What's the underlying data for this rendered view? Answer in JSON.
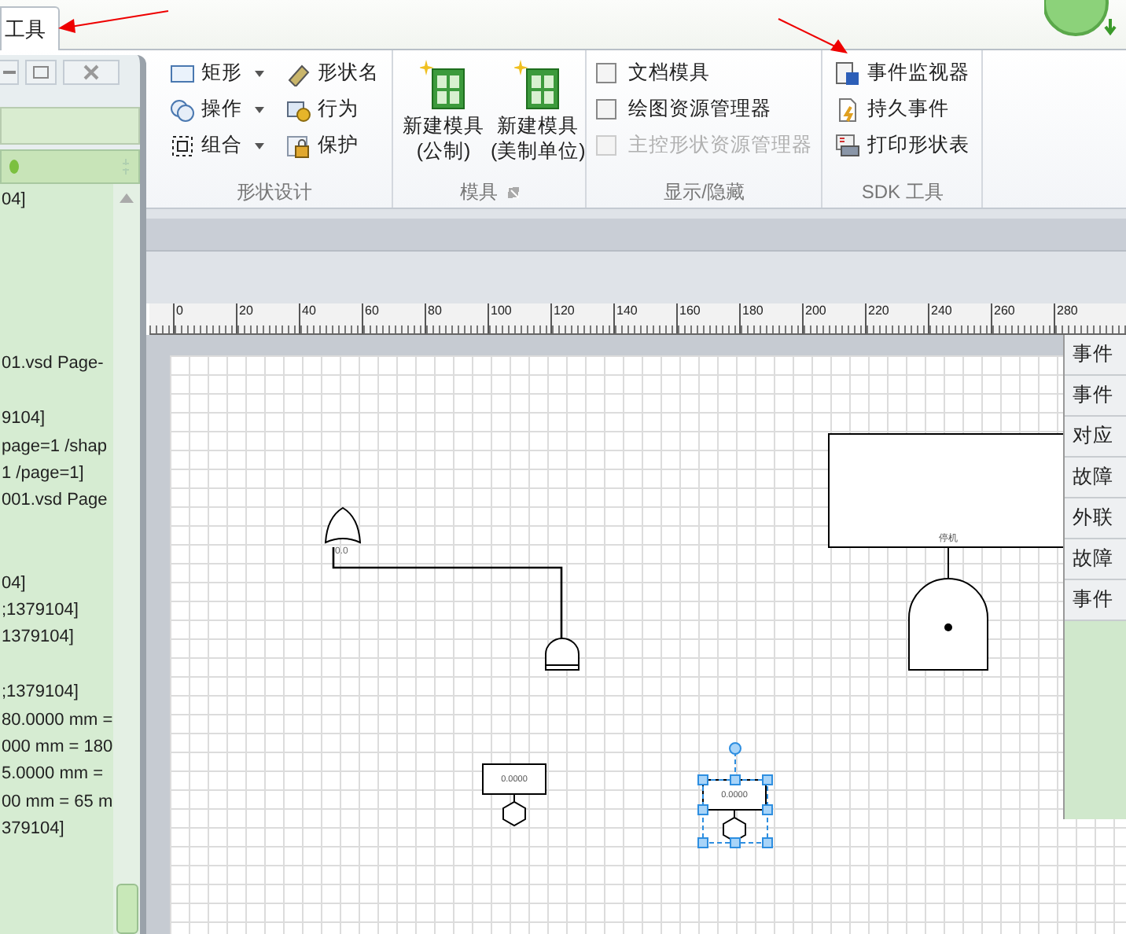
{
  "tab": {
    "label": "工具",
    "selected": true
  },
  "ribbon": {
    "groups": [
      {
        "kind": "small",
        "label": "形状设计",
        "columns": [
          [
            {
              "label": "矩形",
              "dropdown": true
            },
            {
              "label": "操作",
              "dropdown": true
            },
            {
              "label": "组合",
              "dropdown": true
            }
          ],
          [
            {
              "label": "形状名",
              "dropdown": false
            },
            {
              "label": "行为",
              "dropdown": false
            },
            {
              "label": "保护",
              "dropdown": false
            }
          ]
        ]
      },
      {
        "kind": "large",
        "label": "模具",
        "buttons": [
          {
            "label": "新建模具",
            "sub": "(公制)"
          },
          {
            "label": "新建模具",
            "sub": "(美制单位)"
          }
        ]
      },
      {
        "kind": "checks",
        "label": "显示/隐藏",
        "checks": [
          {
            "label": "文档模具",
            "checked": false,
            "disabled": false
          },
          {
            "label": "绘图资源管理器",
            "checked": false,
            "disabled": false
          },
          {
            "label": "主控形状资源管理器",
            "checked": false,
            "disabled": true
          }
        ]
      },
      {
        "kind": "small",
        "label": "SDK 工具",
        "columns": [
          [
            {
              "label": "事件监视器",
              "dropdown": false
            },
            {
              "label": "持久事件",
              "dropdown": false
            },
            {
              "label": "打印形状表",
              "dropdown": false
            }
          ]
        ]
      }
    ]
  },
  "left_panel": {
    "log_groups": [
      [
        "04]"
      ],
      [
        "01.vsd Page-"
      ],
      [
        "9104]",
        "page=1 /shap",
        "1 /page=1]",
        "001.vsd Page"
      ],
      [
        "04]",
        ";1379104]",
        "1379104]"
      ],
      [
        ";1379104]",
        "80.0000 mm =",
        "000 mm = 180",
        "5.0000 mm =",
        "00 mm = 65 m",
        "379104]"
      ]
    ]
  },
  "ruler": {
    "labels": [
      "0",
      "20",
      "40",
      "60",
      "80",
      "100",
      "120",
      "140",
      "160",
      "180",
      "200",
      "220",
      "240",
      "260",
      "280"
    ]
  },
  "diagram": {
    "shapes": [
      {
        "kind": "or_gate",
        "label": "0.0"
      },
      {
        "kind": "and_gate"
      },
      {
        "kind": "event_box",
        "label": "0.0000",
        "selected": false
      },
      {
        "kind": "event_box",
        "label": "0.0000",
        "selected": true
      },
      {
        "kind": "top_box",
        "label": "停机"
      },
      {
        "kind": "gate_dot"
      }
    ]
  },
  "right_panel": {
    "items": [
      "事件",
      "事件",
      "对应",
      "故障",
      "外联",
      "故障",
      "事件"
    ]
  }
}
